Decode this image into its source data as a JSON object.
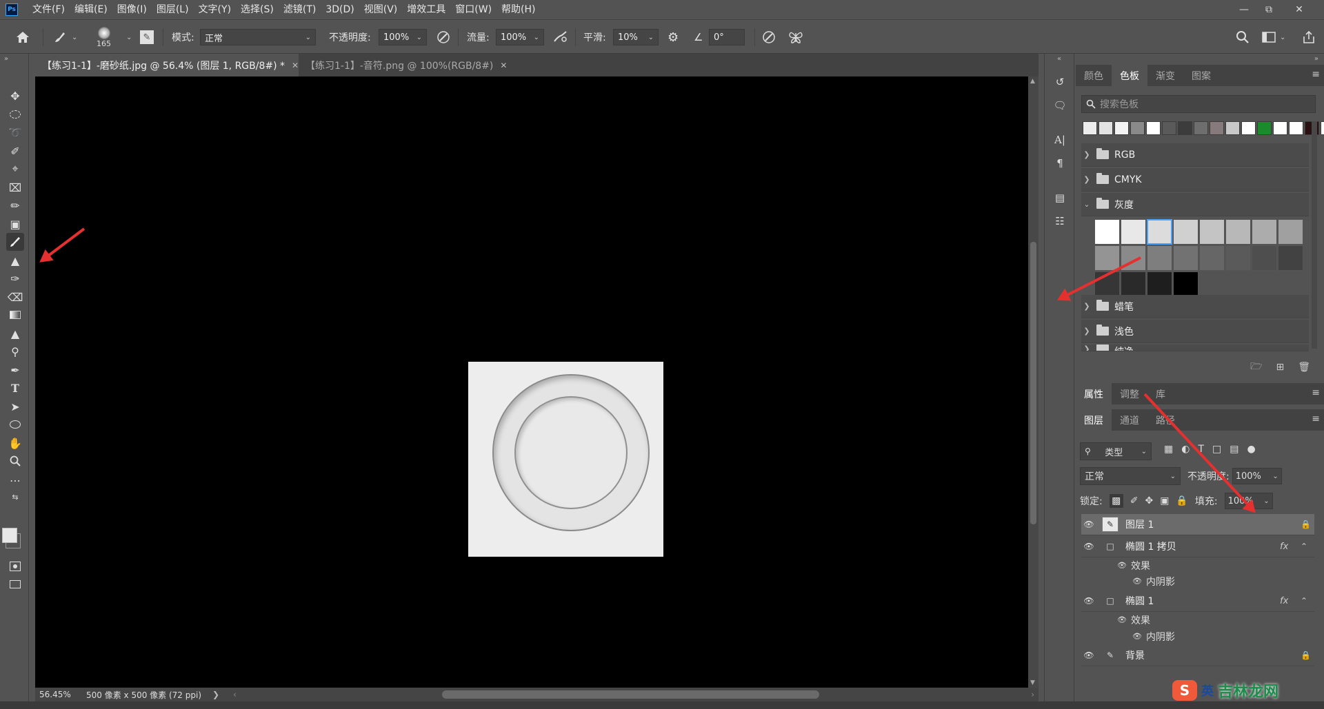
{
  "menubar": {
    "logo": "Ps",
    "items": [
      "文件(F)",
      "编辑(E)",
      "图像(I)",
      "图层(L)",
      "文字(Y)",
      "选择(S)",
      "滤镜(T)",
      "3D(D)",
      "视图(V)",
      "增效工具",
      "窗口(W)",
      "帮助(H)"
    ]
  },
  "options": {
    "brush_size": "165",
    "mode_label": "模式:",
    "mode_value": "正常",
    "opacity_label": "不透明度:",
    "opacity_value": "100%",
    "flow_label": "流量:",
    "flow_value": "100%",
    "smoothing_label": "平滑:",
    "smoothing_value": "10%",
    "angle_value": "0°"
  },
  "tabs": [
    {
      "label": "【练习1-1】-磨砂纸.jpg @ 56.4% (图层 1, RGB/8#) *"
    },
    {
      "label": "【练习1-1】-音符.png @ 100%(RGB/8#)"
    }
  ],
  "status": {
    "zoom": "56.45%",
    "doc_size": "500 像素 x 500 像素 (72 ppi)"
  },
  "swatches_panel": {
    "tabs": [
      "颜色",
      "色板",
      "渐变",
      "图案"
    ],
    "active_tab": "色板",
    "search_placeholder": "搜索色板",
    "recent_colors": [
      "#ececec",
      "#e2e2e2",
      "#f3f3f3",
      "#8a8a8a",
      "#ffffff",
      "#5a5a5a",
      "#3c3c3c",
      "#6e6e6e",
      "#877a7a",
      "#c8c8c8",
      "#ffffff",
      "#1a8a2a",
      "#ffffff",
      "#ffffff",
      "#2a1010",
      "#ffffff"
    ],
    "groups_top": [
      {
        "label": "RGB",
        "expanded": false
      },
      {
        "label": "CMYK",
        "expanded": false
      },
      {
        "label": "灰度",
        "expanded": true
      }
    ],
    "gray_swatches": [
      "#ffffff",
      "#e8e8e8",
      "#dcdcdc",
      "#d0d0d0",
      "#c4c4c4",
      "#b8b8b8",
      "#acacac",
      "#a0a0a0",
      "#949494",
      "#8a8a8a",
      "#7e7e7e",
      "#727272",
      "#666666",
      "#5a5a5a",
      "#4e4e4e",
      "#424242",
      "#363636",
      "#2a2a2a",
      "#1e1e1e",
      "#000000"
    ],
    "selected_gray_index": 2,
    "groups_bottom": [
      {
        "label": "蜡笔"
      },
      {
        "label": "浅色"
      },
      {
        "label": "纯净"
      }
    ]
  },
  "props_panel": {
    "tabs": [
      "属性",
      "调整",
      "库"
    ],
    "active_tab": "属性"
  },
  "layers_panel": {
    "tabs": [
      "图层",
      "通道",
      "路径"
    ],
    "active_tab": "图层",
    "filter_label": "类型",
    "blend_mode": "正常",
    "opacity_label": "不透明度:",
    "opacity_value": "100%",
    "lock_label": "锁定:",
    "fill_label": "填充:",
    "fill_value": "100%",
    "layers": [
      {
        "name": "图层 1",
        "selected": true,
        "fx": "",
        "locked": true
      },
      {
        "name": "椭圆 1 拷贝",
        "selected": false,
        "fx": "fx",
        "locked": false,
        "effects_label": "效果",
        "effect": "内阴影"
      },
      {
        "name": "椭圆 1",
        "selected": false,
        "fx": "fx",
        "locked": false,
        "effects_label": "效果",
        "effect": "内阴影"
      },
      {
        "name": "背景",
        "selected": false,
        "fx": "",
        "locked": true
      }
    ]
  },
  "watermark": {
    "logo_char": "S",
    "lang": "英",
    "text": "吉林龙网"
  },
  "colors": {
    "ui_bg": "#535353",
    "canvas_bg": "#000000",
    "selection_blue": "#4aa3ff",
    "arrow_red": "#e53030"
  }
}
